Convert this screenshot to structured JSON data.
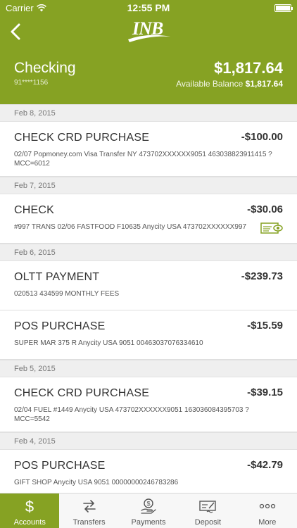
{
  "status_bar": {
    "carrier": "Carrier",
    "time": "12:55 PM",
    "battery_level": 1.0
  },
  "header": {
    "logo_text": "INB",
    "account_name": "Checking",
    "account_number": "91****1156",
    "balance": "$1,817.64",
    "available_label": "Available Balance",
    "available_value": "$1,817.64"
  },
  "groups": [
    {
      "date": "Feb 8, 2015",
      "transactions": [
        {
          "title": "CHECK CRD PURCHASE",
          "amount": "-$100.00",
          "desc": "02/07 Popmoney.com Visa Transfer NY 473702XXXXXX9051 463038823911415 ? MCC=6012"
        }
      ]
    },
    {
      "date": "Feb 7, 2015",
      "transactions": [
        {
          "title": "CHECK",
          "amount": "-$30.06",
          "desc": "#997 TRANS 02/06 FASTFOOD F10635 Anycity USA 473702XXXXXX997",
          "icon": "check-image-icon"
        }
      ]
    },
    {
      "date": "Feb 6, 2015",
      "transactions": [
        {
          "title": "OLTT PAYMENT",
          "amount": "-$239.73",
          "desc": "020513 434599 MONTHLY FEES"
        },
        {
          "title": "POS PURCHASE",
          "amount": "-$15.59",
          "desc": "SUPER MAR 375 R Anycity USA 9051 00463037076334610"
        }
      ]
    },
    {
      "date": "Feb 5, 2015",
      "transactions": [
        {
          "title": "CHECK CRD PURCHASE",
          "amount": "-$39.15",
          "desc": "02/04 FUEL #1449 Anycity USA 473702XXXXXX9051 163036084395703 ? MCC=5542"
        }
      ]
    },
    {
      "date": "Feb 4, 2015",
      "transactions": [
        {
          "title": "POS PURCHASE",
          "amount": "-$42.79",
          "desc": "GIFT SHOP Anycity USA 9051 00000000246783286"
        }
      ]
    }
  ],
  "tabbar": {
    "tabs": [
      {
        "label": "Accounts",
        "icon": "dollar-icon",
        "active": true
      },
      {
        "label": "Transfers",
        "icon": "transfer-arrows-icon",
        "active": false
      },
      {
        "label": "Payments",
        "icon": "payment-hand-icon",
        "active": false
      },
      {
        "label": "Deposit",
        "icon": "check-deposit-icon",
        "active": false
      },
      {
        "label": "More",
        "icon": "more-dots-icon",
        "active": false
      }
    ]
  },
  "colors": {
    "brand_green": "#86a223",
    "date_row_bg": "#efefef"
  }
}
